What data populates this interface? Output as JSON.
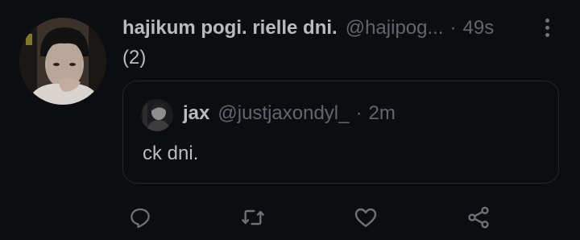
{
  "tweet": {
    "display_name": "hajikum pogi. rielle dni.",
    "handle": "@hajipog...",
    "separator": "·",
    "time": "49s",
    "text": "(2)",
    "more_icon": "more-vertical-icon",
    "avatar_icon": "avatar"
  },
  "quote": {
    "display_name": "jax",
    "handle": "@justjaxondyl_",
    "separator": "·",
    "time": "2m",
    "text": "ck dni."
  },
  "actions": {
    "reply_icon": "reply-icon",
    "retweet_icon": "retweet-icon",
    "like_icon": "like-icon",
    "share_icon": "share-icon"
  },
  "colors": {
    "background": "#0b0d10",
    "primary_text": "#b8bcc0",
    "secondary_text": "#5f666d",
    "border": "#24282c",
    "icon": "#6b7278"
  }
}
